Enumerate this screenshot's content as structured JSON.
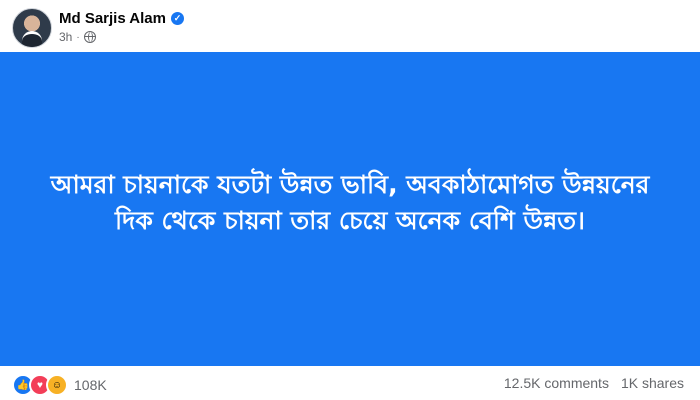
{
  "post": {
    "author": "Md Sarjis Alam",
    "verified_icon": "verified-badge-icon",
    "time": "3h",
    "separator": "·",
    "audience_icon": "globe-icon",
    "text_line1": "আমরা চায়নাকে যতটা উন্নত ভাবি, অবকাঠামোগত উন্নয়নের",
    "text_line2": "দিক থেকে চায়না তার চেয়ে অনেক বেশি উন্নত।",
    "background_color": "#1877f2"
  },
  "footer": {
    "reaction_icons": [
      "like-icon",
      "love-icon",
      "haha-icon"
    ],
    "reaction_count": "108K",
    "comments": "12.5K comments",
    "shares": "1K shares"
  }
}
